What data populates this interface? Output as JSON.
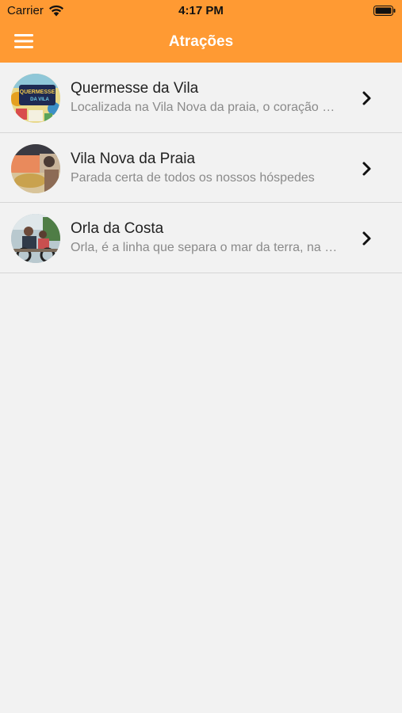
{
  "status_bar": {
    "carrier": "Carrier",
    "time": "4:17 PM",
    "wifi_icon": "wifi-icon",
    "battery_icon": "battery-icon"
  },
  "navbar": {
    "title": "Atrações",
    "menu_icon": "hamburger-menu-icon",
    "background_color": "#ff9a33"
  },
  "attractions": [
    {
      "title": "Quermesse da Vila",
      "subtitle": "Localizada na Vila Nova da praia, o coração da Vila",
      "thumb_sign_text": "QUERMESSE DA VILA"
    },
    {
      "title": "Vila Nova da Praia",
      "subtitle": "Parada certa de todos os nossos hóspedes"
    },
    {
      "title": "Orla da Costa",
      "subtitle": "Orla, é a linha que separa o mar da terra, na costa"
    }
  ]
}
